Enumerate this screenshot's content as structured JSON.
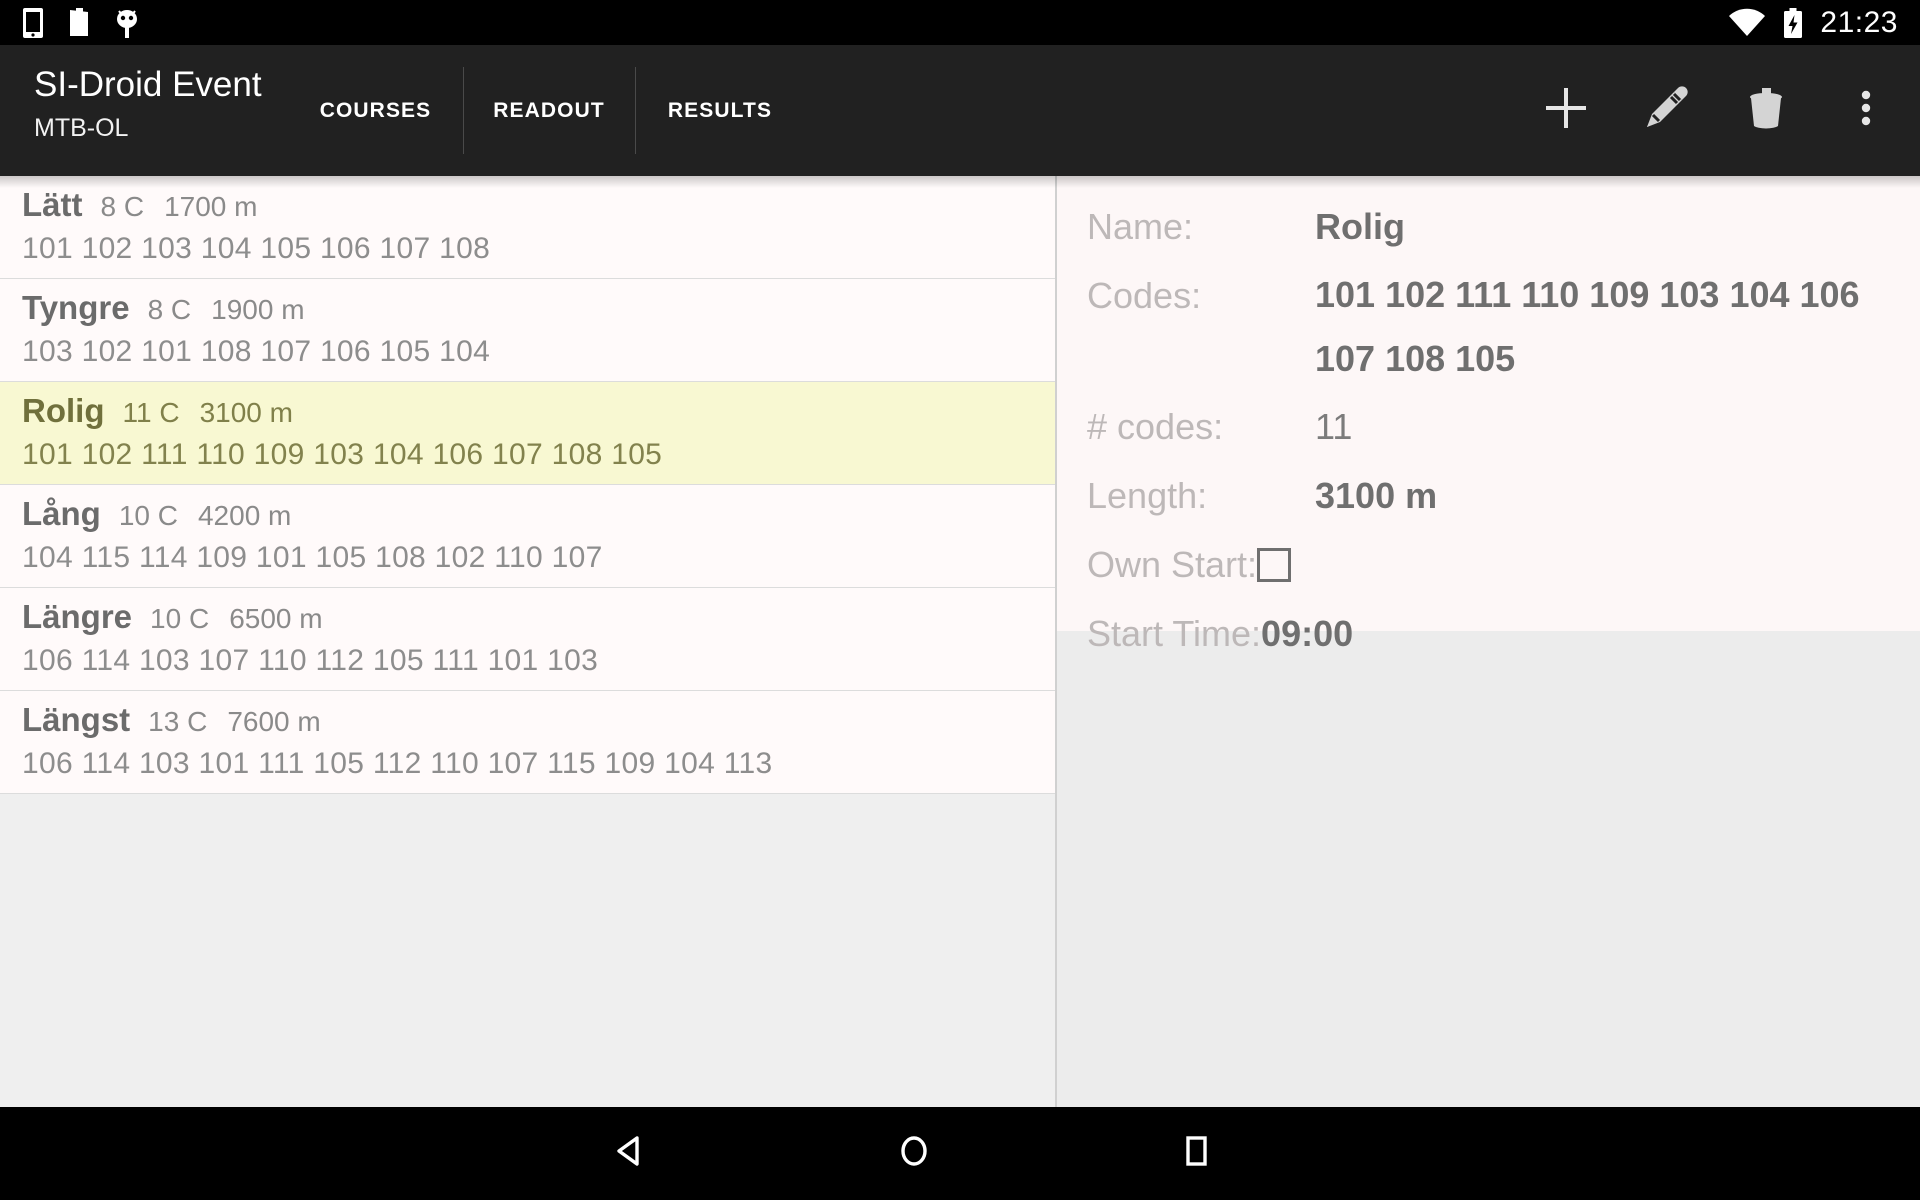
{
  "status_bar": {
    "icons": [
      "phone-icon",
      "document-icon",
      "android-icon",
      "wifi-icon",
      "battery-charging-icon"
    ],
    "clock": "21:23"
  },
  "action_bar": {
    "title": "SI-Droid Event",
    "subtitle": "MTB-OL",
    "tabs": [
      {
        "label": "COURSES",
        "selected": true
      },
      {
        "label": "READOUT",
        "selected": false
      },
      {
        "label": "RESULTS",
        "selected": false
      }
    ],
    "actions": [
      "add-icon",
      "edit-icon",
      "delete-icon",
      "overflow-menu-icon"
    ],
    "accent_color": "#009688",
    "background_color": "#212121"
  },
  "course_list": {
    "selected_index": 2,
    "selected_background": "#f8f8d2",
    "rows": [
      {
        "name": "Lätt",
        "controls": "8 C",
        "length": "1700 m",
        "codes": "101 102 103 104 105 106 107 108"
      },
      {
        "name": "Tyngre",
        "controls": "8 C",
        "length": "1900 m",
        "codes": "103 102 101 108 107 106 105 104"
      },
      {
        "name": "Rolig",
        "controls": "11 C",
        "length": "3100 m",
        "codes": "101 102 111 110 109 103 104 106 107 108 105"
      },
      {
        "name": "Lång",
        "controls": "10 C",
        "length": "4200 m",
        "codes": "104 115 114 109 101 105 108 102 110 107"
      },
      {
        "name": "Längre",
        "controls": "10 C",
        "length": "6500 m",
        "codes": "106 114 103 107 110 112 105 111 101 103"
      },
      {
        "name": "Längst",
        "controls": "13 C",
        "length": "7600 m",
        "codes": "106 114 103 101 111 105 112 110 107 115 109 104 113"
      }
    ]
  },
  "detail": {
    "name_label": "Name:",
    "name_value": "Rolig",
    "codes_label": "Codes:",
    "codes_value": "101 102 111 110 109 103 104 106 107 108 105",
    "numcodes_label": "# codes:",
    "numcodes_value": "11",
    "length_label": "Length:",
    "length_value": "3100 m",
    "ownstart_label": "Own Start:",
    "ownstart_checked": false,
    "starttime_label": "Start Time:",
    "starttime_value": "09:00"
  },
  "nav_bar": {
    "buttons": [
      "back-icon",
      "home-icon",
      "recents-icon"
    ]
  }
}
